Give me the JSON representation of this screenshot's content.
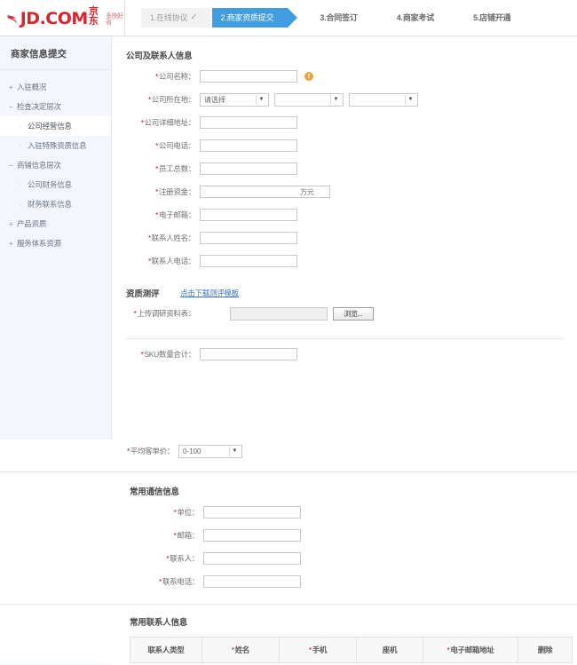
{
  "header": {
    "logo": {
      "brand": "JD",
      "suffix": ".COM",
      "cn": "京东",
      "slogan": "多快好省"
    },
    "steps": [
      {
        "label": "1.在线协议",
        "state": "done",
        "tick": "✓"
      },
      {
        "label": "2.商家资质提交",
        "state": "active"
      },
      {
        "label": "3.合同签订",
        "state": "plain"
      },
      {
        "label": "4.商家考试",
        "state": "plain"
      },
      {
        "label": "5.店铺开通",
        "state": "plain"
      }
    ]
  },
  "sidebar": {
    "title": "商家信息提交",
    "items": [
      {
        "label": "入驻概况",
        "mark": "+",
        "level": 0,
        "current": false
      },
      {
        "label": "检查决定层次",
        "mark": "−",
        "level": 0,
        "current": false
      },
      {
        "label": "公司经营信息",
        "mark": "·",
        "level": 1,
        "current": true
      },
      {
        "label": "入驻特殊资质信息",
        "mark": "·",
        "level": 1,
        "current": false
      },
      {
        "label": "商铺信息层次",
        "mark": "−",
        "level": 0,
        "current": false
      },
      {
        "label": "公司财务信息",
        "mark": "·",
        "level": 1,
        "current": false
      },
      {
        "label": "财务联系信息",
        "mark": "·",
        "level": 1,
        "current": false
      },
      {
        "label": "产品资质",
        "mark": "+",
        "level": 0,
        "current": false
      },
      {
        "label": "服务体系资源",
        "mark": "+",
        "level": 0,
        "current": false
      }
    ]
  },
  "form": {
    "section_company": "公司及联系人信息",
    "fields": [
      {
        "label": "公司名称：",
        "required": true,
        "type": "text",
        "value": "",
        "warn": true
      },
      {
        "label": "公司详细地址：",
        "required": true,
        "type": "text",
        "value": ""
      },
      {
        "label": "公司电话：",
        "required": true,
        "type": "text",
        "value": ""
      },
      {
        "label": "员工总数：",
        "required": true,
        "type": "text",
        "value": ""
      },
      {
        "label": "注册资金：",
        "required": true,
        "type": "text",
        "value": "",
        "unit": "万元"
      },
      {
        "label": "电子邮箱：",
        "required": true,
        "type": "text",
        "value": ""
      },
      {
        "label": "联系人姓名：",
        "required": true,
        "type": "text",
        "value": ""
      },
      {
        "label": "联系人电话：",
        "required": true,
        "type": "text",
        "value": ""
      }
    ],
    "location": {
      "label": "公司所在地：",
      "required": true,
      "selects": [
        {
          "value": "请选择",
          "blank": false
        },
        {
          "value": "",
          "blank": true
        },
        {
          "value": "",
          "blank": true
        }
      ]
    },
    "assessment": {
      "title": "资质测评",
      "download_link": "点击下载测评模板",
      "upload_label": "上传调研资料表：",
      "upload_required": true,
      "upload_value": "",
      "browse_button": "浏览..."
    },
    "sku": {
      "label": "SKU数量合计：",
      "required": true,
      "value": ""
    },
    "avg_price": {
      "label": "平均客单价：",
      "required": true,
      "selected": "0-100"
    },
    "section_contact_info": "常用通信信息",
    "contact_fields": [
      {
        "label": "单位：",
        "required": true,
        "value": ""
      },
      {
        "label": "邮箱：",
        "required": true,
        "value": ""
      },
      {
        "label": "联系人：",
        "required": true,
        "value": ""
      },
      {
        "label": "联系电话：",
        "required": true,
        "value": ""
      }
    ],
    "section_contacts": "常用联系人信息",
    "contacts_table": {
      "columns": [
        {
          "label": "联系人类型",
          "required": false
        },
        {
          "label": "姓名",
          "required": true
        },
        {
          "label": "手机",
          "required": true
        },
        {
          "label": "座机",
          "required": false
        },
        {
          "label": "电子邮箱地址",
          "required": true
        },
        {
          "label": "删除",
          "required": false
        }
      ]
    }
  }
}
